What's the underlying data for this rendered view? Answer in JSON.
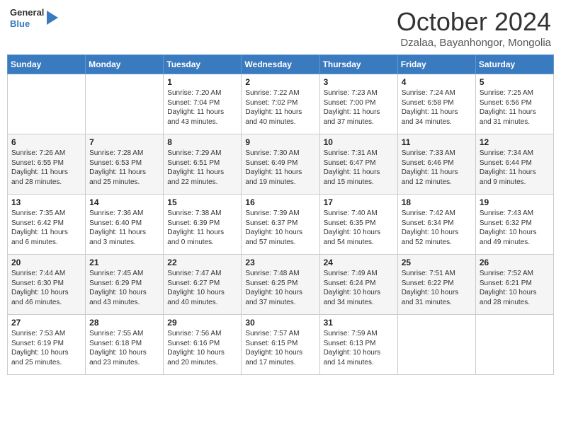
{
  "header": {
    "logo": {
      "general": "General",
      "blue": "Blue"
    },
    "title": "October 2024",
    "location": "Dzalaa, Bayanhongor, Mongolia"
  },
  "weekdays": [
    "Sunday",
    "Monday",
    "Tuesday",
    "Wednesday",
    "Thursday",
    "Friday",
    "Saturday"
  ],
  "weeks": [
    [
      {
        "day": null,
        "sunrise": null,
        "sunset": null,
        "daylight": null
      },
      {
        "day": null,
        "sunrise": null,
        "sunset": null,
        "daylight": null
      },
      {
        "day": "1",
        "sunrise": "Sunrise: 7:20 AM",
        "sunset": "Sunset: 7:04 PM",
        "daylight": "Daylight: 11 hours and 43 minutes."
      },
      {
        "day": "2",
        "sunrise": "Sunrise: 7:22 AM",
        "sunset": "Sunset: 7:02 PM",
        "daylight": "Daylight: 11 hours and 40 minutes."
      },
      {
        "day": "3",
        "sunrise": "Sunrise: 7:23 AM",
        "sunset": "Sunset: 7:00 PM",
        "daylight": "Daylight: 11 hours and 37 minutes."
      },
      {
        "day": "4",
        "sunrise": "Sunrise: 7:24 AM",
        "sunset": "Sunset: 6:58 PM",
        "daylight": "Daylight: 11 hours and 34 minutes."
      },
      {
        "day": "5",
        "sunrise": "Sunrise: 7:25 AM",
        "sunset": "Sunset: 6:56 PM",
        "daylight": "Daylight: 11 hours and 31 minutes."
      }
    ],
    [
      {
        "day": "6",
        "sunrise": "Sunrise: 7:26 AM",
        "sunset": "Sunset: 6:55 PM",
        "daylight": "Daylight: 11 hours and 28 minutes."
      },
      {
        "day": "7",
        "sunrise": "Sunrise: 7:28 AM",
        "sunset": "Sunset: 6:53 PM",
        "daylight": "Daylight: 11 hours and 25 minutes."
      },
      {
        "day": "8",
        "sunrise": "Sunrise: 7:29 AM",
        "sunset": "Sunset: 6:51 PM",
        "daylight": "Daylight: 11 hours and 22 minutes."
      },
      {
        "day": "9",
        "sunrise": "Sunrise: 7:30 AM",
        "sunset": "Sunset: 6:49 PM",
        "daylight": "Daylight: 11 hours and 19 minutes."
      },
      {
        "day": "10",
        "sunrise": "Sunrise: 7:31 AM",
        "sunset": "Sunset: 6:47 PM",
        "daylight": "Daylight: 11 hours and 15 minutes."
      },
      {
        "day": "11",
        "sunrise": "Sunrise: 7:33 AM",
        "sunset": "Sunset: 6:46 PM",
        "daylight": "Daylight: 11 hours and 12 minutes."
      },
      {
        "day": "12",
        "sunrise": "Sunrise: 7:34 AM",
        "sunset": "Sunset: 6:44 PM",
        "daylight": "Daylight: 11 hours and 9 minutes."
      }
    ],
    [
      {
        "day": "13",
        "sunrise": "Sunrise: 7:35 AM",
        "sunset": "Sunset: 6:42 PM",
        "daylight": "Daylight: 11 hours and 6 minutes."
      },
      {
        "day": "14",
        "sunrise": "Sunrise: 7:36 AM",
        "sunset": "Sunset: 6:40 PM",
        "daylight": "Daylight: 11 hours and 3 minutes."
      },
      {
        "day": "15",
        "sunrise": "Sunrise: 7:38 AM",
        "sunset": "Sunset: 6:39 PM",
        "daylight": "Daylight: 11 hours and 0 minutes."
      },
      {
        "day": "16",
        "sunrise": "Sunrise: 7:39 AM",
        "sunset": "Sunset: 6:37 PM",
        "daylight": "Daylight: 10 hours and 57 minutes."
      },
      {
        "day": "17",
        "sunrise": "Sunrise: 7:40 AM",
        "sunset": "Sunset: 6:35 PM",
        "daylight": "Daylight: 10 hours and 54 minutes."
      },
      {
        "day": "18",
        "sunrise": "Sunrise: 7:42 AM",
        "sunset": "Sunset: 6:34 PM",
        "daylight": "Daylight: 10 hours and 52 minutes."
      },
      {
        "day": "19",
        "sunrise": "Sunrise: 7:43 AM",
        "sunset": "Sunset: 6:32 PM",
        "daylight": "Daylight: 10 hours and 49 minutes."
      }
    ],
    [
      {
        "day": "20",
        "sunrise": "Sunrise: 7:44 AM",
        "sunset": "Sunset: 6:30 PM",
        "daylight": "Daylight: 10 hours and 46 minutes."
      },
      {
        "day": "21",
        "sunrise": "Sunrise: 7:45 AM",
        "sunset": "Sunset: 6:29 PM",
        "daylight": "Daylight: 10 hours and 43 minutes."
      },
      {
        "day": "22",
        "sunrise": "Sunrise: 7:47 AM",
        "sunset": "Sunset: 6:27 PM",
        "daylight": "Daylight: 10 hours and 40 minutes."
      },
      {
        "day": "23",
        "sunrise": "Sunrise: 7:48 AM",
        "sunset": "Sunset: 6:25 PM",
        "daylight": "Daylight: 10 hours and 37 minutes."
      },
      {
        "day": "24",
        "sunrise": "Sunrise: 7:49 AM",
        "sunset": "Sunset: 6:24 PM",
        "daylight": "Daylight: 10 hours and 34 minutes."
      },
      {
        "day": "25",
        "sunrise": "Sunrise: 7:51 AM",
        "sunset": "Sunset: 6:22 PM",
        "daylight": "Daylight: 10 hours and 31 minutes."
      },
      {
        "day": "26",
        "sunrise": "Sunrise: 7:52 AM",
        "sunset": "Sunset: 6:21 PM",
        "daylight": "Daylight: 10 hours and 28 minutes."
      }
    ],
    [
      {
        "day": "27",
        "sunrise": "Sunrise: 7:53 AM",
        "sunset": "Sunset: 6:19 PM",
        "daylight": "Daylight: 10 hours and 25 minutes."
      },
      {
        "day": "28",
        "sunrise": "Sunrise: 7:55 AM",
        "sunset": "Sunset: 6:18 PM",
        "daylight": "Daylight: 10 hours and 23 minutes."
      },
      {
        "day": "29",
        "sunrise": "Sunrise: 7:56 AM",
        "sunset": "Sunset: 6:16 PM",
        "daylight": "Daylight: 10 hours and 20 minutes."
      },
      {
        "day": "30",
        "sunrise": "Sunrise: 7:57 AM",
        "sunset": "Sunset: 6:15 PM",
        "daylight": "Daylight: 10 hours and 17 minutes."
      },
      {
        "day": "31",
        "sunrise": "Sunrise: 7:59 AM",
        "sunset": "Sunset: 6:13 PM",
        "daylight": "Daylight: 10 hours and 14 minutes."
      },
      {
        "day": null,
        "sunrise": null,
        "sunset": null,
        "daylight": null
      },
      {
        "day": null,
        "sunrise": null,
        "sunset": null,
        "daylight": null
      }
    ]
  ]
}
